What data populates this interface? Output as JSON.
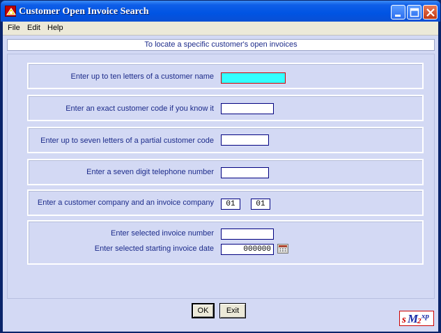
{
  "window": {
    "title": "Customer Open Invoice Search",
    "accent": "#0054e3"
  },
  "menu": {
    "file": "File",
    "edit": "Edit",
    "help": "Help"
  },
  "hint": "To locate a specific customer's open invoices",
  "fields": {
    "customer_name": {
      "label": "Enter up to ten letters of a customer name",
      "value": ""
    },
    "customer_code": {
      "label": "Enter an exact customer code if you know it",
      "value": ""
    },
    "partial_code": {
      "label": "Enter up to seven letters of a partial customer code",
      "value": ""
    },
    "telephone": {
      "label": "Enter a seven digit telephone number",
      "value": ""
    },
    "company": {
      "label": "Enter a customer company and an invoice company",
      "customer_company": "01",
      "invoice_company": "01"
    },
    "invoice_number": {
      "label": "Enter selected invoice number",
      "value": ""
    },
    "invoice_date": {
      "label": "Enter selected starting invoice date",
      "value": "000000"
    }
  },
  "buttons": {
    "ok": "OK",
    "exit": "Exit"
  },
  "logo": {
    "text_s": "s",
    "text_m": "M",
    "text_2": "2",
    "text_xp": "xp"
  },
  "icons": [
    "app-icon",
    "minimize-icon",
    "maximize-icon",
    "close-icon",
    "calendar-icon"
  ]
}
